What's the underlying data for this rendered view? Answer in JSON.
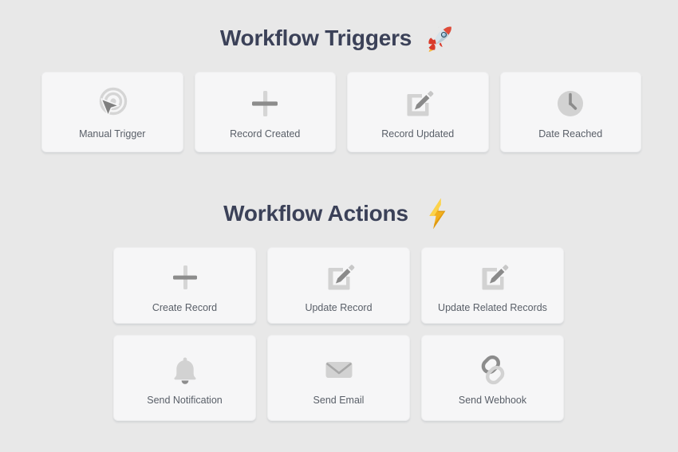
{
  "page": {
    "background_color": "#e8e8e8",
    "card_color": "#f6f6f7",
    "heading_color": "#3b4158",
    "label_color": "#595f68"
  },
  "triggers_section": {
    "heading": "Workflow Triggers",
    "emoji_name": "rocket-emoji",
    "cards": [
      {
        "label": "Manual Trigger",
        "icon": "cursor-target-icon"
      },
      {
        "label": "Record Created",
        "icon": "plus-icon"
      },
      {
        "label": "Record Updated",
        "icon": "edit-pencil-square-icon"
      },
      {
        "label": "Date Reached",
        "icon": "clock-icon"
      }
    ]
  },
  "actions_section": {
    "heading": "Workflow Actions",
    "emoji_name": "lightning-bolt-emoji",
    "cards": [
      {
        "label": "Create Record",
        "icon": "plus-icon"
      },
      {
        "label": "Update Record",
        "icon": "edit-pencil-square-icon"
      },
      {
        "label": "Update Related Records",
        "icon": "edit-pencil-square-icon"
      },
      {
        "label": "Send Notification",
        "icon": "bell-icon"
      },
      {
        "label": "Send Email",
        "icon": "envelope-icon"
      },
      {
        "label": "Send Webhook",
        "icon": "link-chain-icon"
      }
    ]
  }
}
